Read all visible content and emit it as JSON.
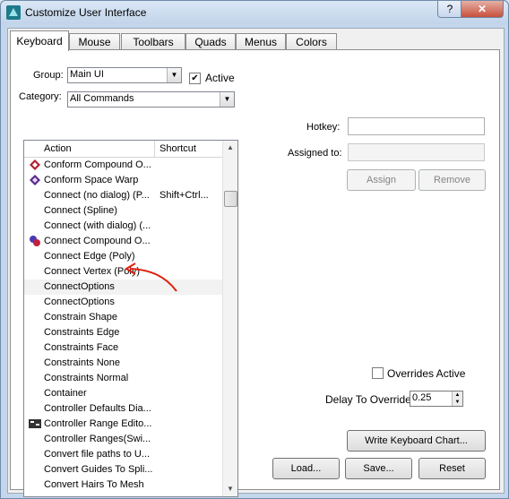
{
  "window": {
    "title": "Customize User Interface",
    "help_label": "?",
    "close_label": "✕"
  },
  "tabs": [
    {
      "label": "Keyboard",
      "active": true
    },
    {
      "label": "Mouse"
    },
    {
      "label": "Toolbars"
    },
    {
      "label": "Quads"
    },
    {
      "label": "Menus"
    },
    {
      "label": "Colors"
    }
  ],
  "group": {
    "label": "Group:",
    "value": "Main UI",
    "active_label": "Active",
    "active_checked": "✔"
  },
  "category": {
    "label": "Category:",
    "value": "All Commands"
  },
  "action_list": {
    "columns": {
      "action": "Action",
      "shortcut": "Shortcut"
    },
    "rows": [
      {
        "action": "Conform Compound O...",
        "shortcut": "",
        "icon": "conform-compound-icon"
      },
      {
        "action": "Conform Space Warp",
        "shortcut": "",
        "icon": "conform-spacewarp-icon"
      },
      {
        "action": "Connect (no dialog) (P...",
        "shortcut": "Shift+Ctrl...",
        "icon": ""
      },
      {
        "action": "Connect (Spline)",
        "shortcut": "",
        "icon": ""
      },
      {
        "action": "Connect (with dialog) (...",
        "shortcut": "",
        "icon": ""
      },
      {
        "action": "Connect Compound O...",
        "shortcut": "",
        "icon": "connect-compound-icon"
      },
      {
        "action": "Connect Edge (Poly)",
        "shortcut": "",
        "icon": ""
      },
      {
        "action": "Connect Vertex (Poly)",
        "shortcut": "",
        "icon": ""
      },
      {
        "action": "ConnectOptions",
        "shortcut": "",
        "icon": "",
        "highlighted": true
      },
      {
        "action": "ConnectOptions",
        "shortcut": "",
        "icon": ""
      },
      {
        "action": "Constrain Shape",
        "shortcut": "",
        "icon": ""
      },
      {
        "action": "Constraints Edge",
        "shortcut": "",
        "icon": ""
      },
      {
        "action": "Constraints Face",
        "shortcut": "",
        "icon": ""
      },
      {
        "action": "Constraints None",
        "shortcut": "",
        "icon": ""
      },
      {
        "action": "Constraints Normal",
        "shortcut": "",
        "icon": ""
      },
      {
        "action": "Container",
        "shortcut": "",
        "icon": ""
      },
      {
        "action": "Controller Defaults Dia...",
        "shortcut": "",
        "icon": ""
      },
      {
        "action": "Controller Range Edito...",
        "shortcut": "",
        "icon": "controller-range-icon"
      },
      {
        "action": "Controller Ranges(Swi...",
        "shortcut": "",
        "icon": ""
      },
      {
        "action": "Convert file paths to U...",
        "shortcut": "",
        "icon": ""
      },
      {
        "action": "Convert Guides To Spli...",
        "shortcut": "",
        "icon": ""
      },
      {
        "action": "Convert Hairs To Mesh",
        "shortcut": "",
        "icon": ""
      }
    ]
  },
  "hotkey": {
    "hotkey_label": "Hotkey:",
    "hotkey_value": "",
    "assigned_label": "Assigned to:",
    "assigned_value": "",
    "assign_label": "Assign",
    "remove_label": "Remove"
  },
  "overrides": {
    "label": "Overrides Active",
    "delay_label": "Delay To Override:",
    "delay_value": "0.25"
  },
  "buttons": {
    "write_chart": "Write Keyboard Chart...",
    "load": "Load...",
    "save": "Save...",
    "reset": "Reset"
  },
  "colors": {
    "annotation": "#e02010",
    "titlebar": "#c1d4ea"
  }
}
